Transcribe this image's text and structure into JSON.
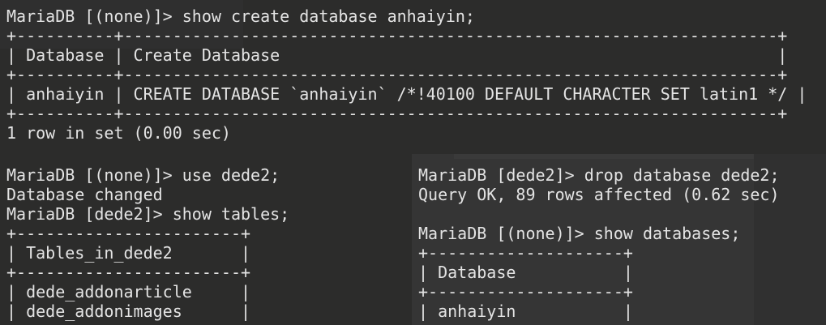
{
  "main": [
    "MariaDB [(none)]> show create database anhaiyin;",
    "+----------+-------------------------------------------------------------------+",
    "| Database | Create Database                                                   |",
    "+----------+-------------------------------------------------------------------+",
    "| anhaiyin | CREATE DATABASE `anhaiyin` /*!40100 DEFAULT CHARACTER SET latin1 */ |",
    "+----------+-------------------------------------------------------------------+",
    "1 row in set (0.00 sec)"
  ],
  "left": [
    "MariaDB [(none)]> use dede2;",
    "Database changed",
    "MariaDB [dede2]> show tables;",
    "+-----------------------+",
    "| Tables_in_dede2       |",
    "+-----------------------+",
    "| dede_addonarticle     |",
    "| dede_addonimages      |"
  ],
  "right": [
    "MariaDB [dede2]> drop database dede2;",
    "Query OK, 89 rows affected (0.62 sec)",
    "",
    "MariaDB [(none)]> show databases;",
    "+--------------------+",
    "| Database           |",
    "+--------------------+",
    "| anhaiyin           |"
  ]
}
